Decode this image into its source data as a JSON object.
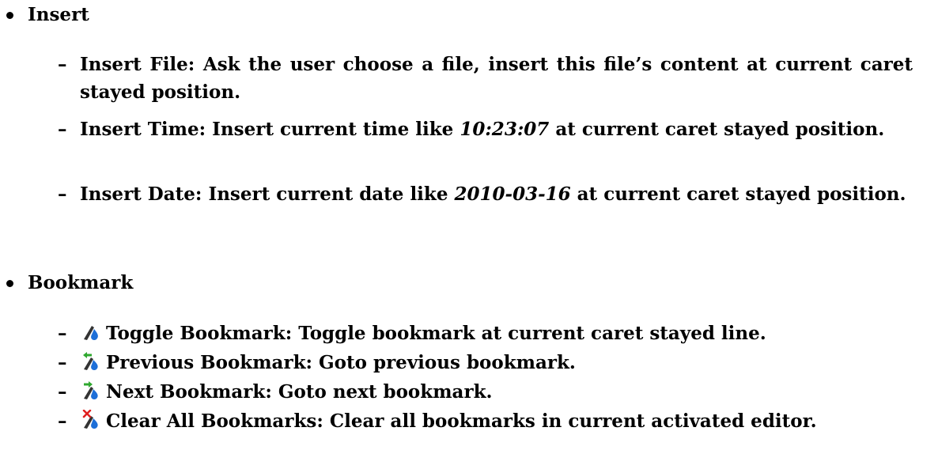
{
  "sections": [
    {
      "title": "Insert",
      "items": [
        {
          "term": "Insert File:",
          "text": "Ask the user choose a file, insert this file’s content at current caret stayed position."
        },
        {
          "term": "Insert Time:",
          "before": "Insert current time like",
          "example": "10:23:07",
          "after": "at current caret stayed position."
        },
        {
          "term": "Insert Date:",
          "before": "Insert current date like",
          "example": "2010-03-16",
          "after": "at current caret stayed position."
        }
      ]
    },
    {
      "title": "Bookmark",
      "items": [
        {
          "icon": "toggle-bookmark-icon",
          "term": "Toggle Bookmark:",
          "text": "Toggle bookmark at current caret stayed line."
        },
        {
          "icon": "previous-bookmark-icon",
          "term": "Previous Bookmark:",
          "text": "Goto previous bookmark."
        },
        {
          "icon": "next-bookmark-icon",
          "term": "Next Bookmark:",
          "text": "Goto next bookmark."
        },
        {
          "icon": "clear-all-bookmarks-icon",
          "term": "Clear All Bookmarks:",
          "text": "Clear all bookmarks in current activated editor."
        }
      ]
    }
  ],
  "dash": "–",
  "colors": {
    "icon_blue": "#1d6fd8",
    "icon_dark": "#333333",
    "arrow_green": "#2fa82f",
    "cross_red": "#e02020"
  }
}
